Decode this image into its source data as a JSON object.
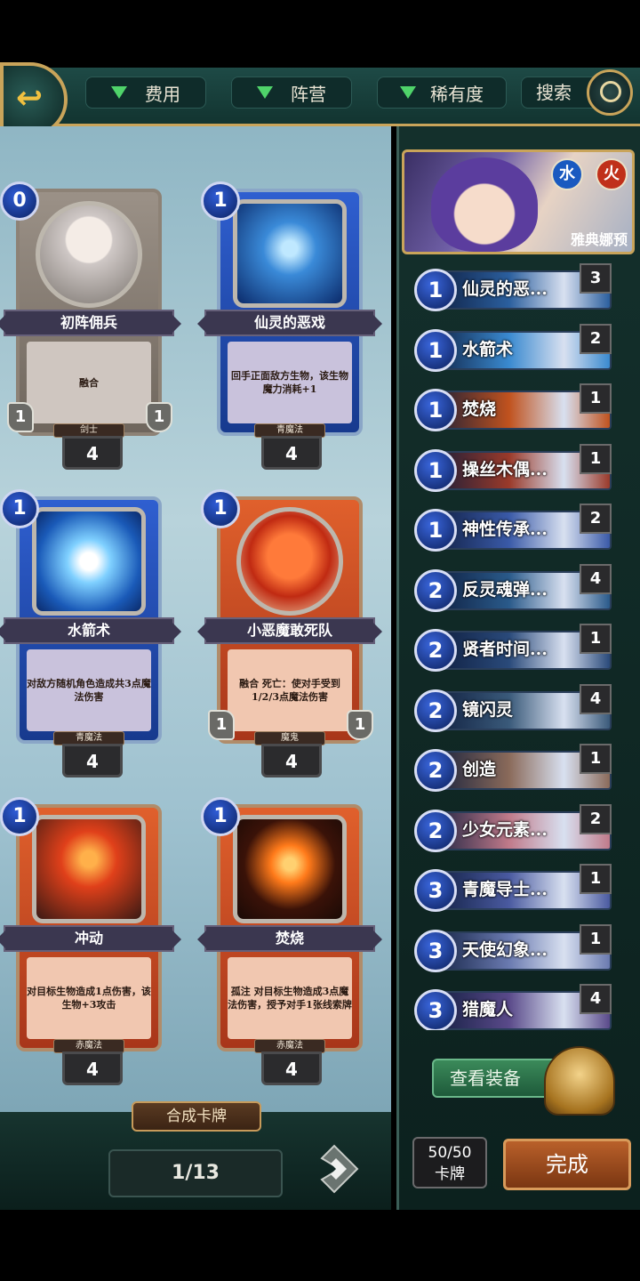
{
  "filters": {
    "cost": "费用",
    "faction": "阵营",
    "rarity": "稀有度",
    "search": "搜索"
  },
  "cards": [
    {
      "cost": "0",
      "name": "初阵佣兵",
      "desc": "融合",
      "type": "剑士",
      "attack": "1",
      "health": "1",
      "count": "4"
    },
    {
      "cost": "1",
      "name": "仙灵的恶戏",
      "desc": "回手正面敌方生物，该生物魔力消耗+1",
      "type": "青魔法",
      "count": "4"
    },
    {
      "cost": "1",
      "name": "水箭术",
      "desc": "对敌方随机角色造成共3点魔法伤害",
      "type": "青魔法",
      "count": "4"
    },
    {
      "cost": "1",
      "name": "小恶魔敢死队",
      "desc": "融合 死亡：使对手受到1/2/3点魔法伤害",
      "type": "魔鬼",
      "attack": "1",
      "health": "1",
      "count": "4"
    },
    {
      "cost": "1",
      "name": "冲动",
      "desc": "对目标生物造成1点伤害，该生物+3攻击",
      "type": "赤魔法",
      "count": "4"
    },
    {
      "cost": "1",
      "name": "焚烧",
      "desc": "孤注 对目标生物造成3点魔法伤害，授予对手1张线索牌",
      "type": "赤魔法",
      "count": "4"
    }
  ],
  "craft_label": "合成卡牌",
  "page_indicator": "1/13",
  "hero": {
    "name": "雅典娜预",
    "element_water": "水",
    "element_fire": "火"
  },
  "deck": [
    {
      "cost": "1",
      "name": "仙灵的恶...",
      "count": "3",
      "color": "#2b5f9e"
    },
    {
      "cost": "1",
      "name": "水箭术",
      "count": "2",
      "color": "#3a8ad0"
    },
    {
      "cost": "1",
      "name": "焚烧",
      "count": "1",
      "color": "#c0521e"
    },
    {
      "cost": "1",
      "name": "操丝木偶...",
      "count": "1",
      "color": "#9a3a2a"
    },
    {
      "cost": "1",
      "name": "神性传承...",
      "count": "2",
      "color": "#3a5aa8"
    },
    {
      "cost": "2",
      "name": "反灵魂弹...",
      "count": "4",
      "color": "#2a5a8a"
    },
    {
      "cost": "2",
      "name": "贤者时间...",
      "count": "1",
      "color": "#2a4a7a"
    },
    {
      "cost": "2",
      "name": "镜闪灵",
      "count": "4",
      "color": "#3a5a7a"
    },
    {
      "cost": "2",
      "name": "创造",
      "count": "1",
      "color": "#8a6a5a"
    },
    {
      "cost": "2",
      "name": "少女元素...",
      "count": "2",
      "color": "#c07a8a"
    },
    {
      "cost": "3",
      "name": "青魔导士...",
      "count": "1",
      "color": "#4a5aa0"
    },
    {
      "cost": "3",
      "name": "天使幻象...",
      "count": "1",
      "color": "#6a7ab0"
    },
    {
      "cost": "3",
      "name": "猎魔人",
      "count": "4",
      "color": "#5a4a8a"
    }
  ],
  "equip_label": "查看装备",
  "deck_count": {
    "value": "50/50",
    "label": "卡牌"
  },
  "done_label": "完成"
}
